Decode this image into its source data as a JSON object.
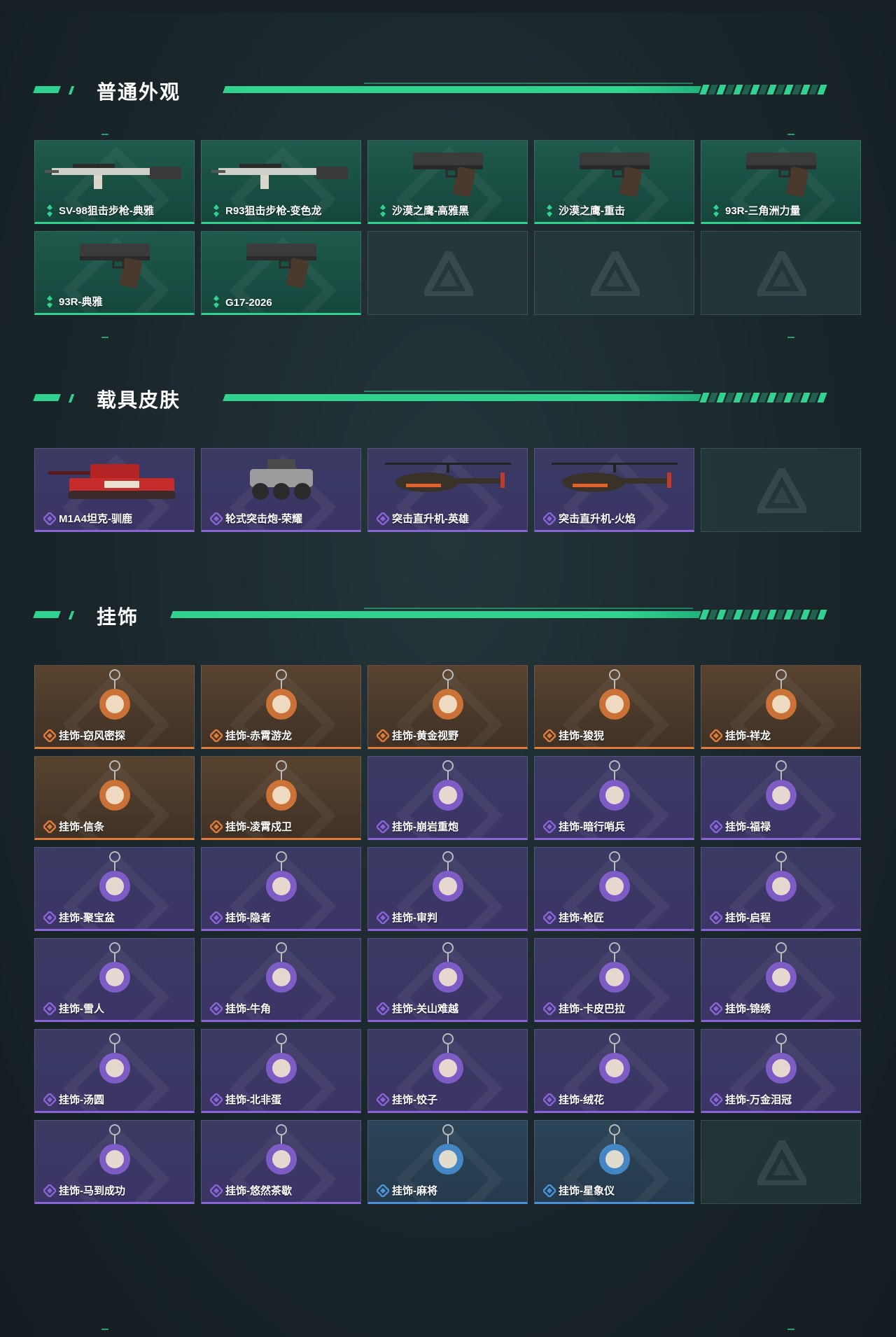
{
  "sections": [
    {
      "title": "普通外观",
      "items": [
        {
          "name": "SV-98狙击步枪-典雅",
          "tier": "green",
          "icon": "sniper-rifle-icon"
        },
        {
          "name": "R93狙击步枪-变色龙",
          "tier": "green",
          "icon": "sniper-rifle-icon"
        },
        {
          "name": "沙漠之鹰-高雅黑",
          "tier": "green",
          "icon": "pistol-icon"
        },
        {
          "name": "沙漠之鹰-重击",
          "tier": "green",
          "icon": "pistol-icon"
        },
        {
          "name": "93R-三角洲力量",
          "tier": "green",
          "icon": "pistol-icon"
        },
        {
          "name": "93R-典雅",
          "tier": "green",
          "icon": "pistol-icon"
        },
        {
          "name": "G17-2026",
          "tier": "green",
          "icon": "pistol-icon"
        }
      ],
      "empty_slots": 3
    },
    {
      "title": "载具皮肤",
      "items": [
        {
          "name": "M1A4坦克-驯鹿",
          "tier": "purple",
          "icon": "tank-icon"
        },
        {
          "name": "轮式突击炮-荣耀",
          "tier": "purple",
          "icon": "armored-car-icon"
        },
        {
          "name": "突击直升机-英雄",
          "tier": "purple",
          "icon": "helicopter-icon"
        },
        {
          "name": "突击直升机-火焰",
          "tier": "purple",
          "icon": "helicopter-icon"
        }
      ],
      "empty_slots": 1
    },
    {
      "title": "挂饰",
      "items": [
        {
          "name": "挂饰-窃风密探",
          "tier": "orange",
          "icon": "charm-icon"
        },
        {
          "name": "挂饰-赤霄游龙",
          "tier": "orange",
          "icon": "charm-icon"
        },
        {
          "name": "挂饰-黄金视野",
          "tier": "orange",
          "icon": "charm-icon"
        },
        {
          "name": "挂饰-狻猊",
          "tier": "orange",
          "icon": "charm-icon"
        },
        {
          "name": "挂饰-祥龙",
          "tier": "orange",
          "icon": "charm-icon"
        },
        {
          "name": "挂饰-信条",
          "tier": "orange",
          "icon": "charm-icon"
        },
        {
          "name": "挂饰-凌霄戍卫",
          "tier": "orange",
          "icon": "charm-icon"
        },
        {
          "name": "挂饰-崩岩重炮",
          "tier": "purple",
          "icon": "charm-icon"
        },
        {
          "name": "挂饰-暗行哨兵",
          "tier": "purple",
          "icon": "charm-icon"
        },
        {
          "name": "挂饰-福禄",
          "tier": "purple",
          "icon": "charm-icon"
        },
        {
          "name": "挂饰-聚宝盆",
          "tier": "purple",
          "icon": "charm-icon"
        },
        {
          "name": "挂饰-隐者",
          "tier": "purple",
          "icon": "charm-icon"
        },
        {
          "name": "挂饰-审判",
          "tier": "purple",
          "icon": "charm-icon"
        },
        {
          "name": "挂饰-枪匠",
          "tier": "purple",
          "icon": "charm-icon"
        },
        {
          "name": "挂饰-启程",
          "tier": "purple",
          "icon": "charm-icon"
        },
        {
          "name": "挂饰-雪人",
          "tier": "purple",
          "icon": "charm-icon"
        },
        {
          "name": "挂饰-牛角",
          "tier": "purple",
          "icon": "charm-icon"
        },
        {
          "name": "挂饰-关山难越",
          "tier": "purple",
          "icon": "charm-icon"
        },
        {
          "name": "挂饰-卡皮巴拉",
          "tier": "purple",
          "icon": "charm-icon"
        },
        {
          "name": "挂饰-锦绣",
          "tier": "purple",
          "icon": "charm-icon"
        },
        {
          "name": "挂饰-汤圆",
          "tier": "purple",
          "icon": "charm-icon"
        },
        {
          "name": "挂饰-北非蛋",
          "tier": "purple",
          "icon": "charm-icon"
        },
        {
          "name": "挂饰-饺子",
          "tier": "purple",
          "icon": "charm-icon"
        },
        {
          "name": "挂饰-绒花",
          "tier": "purple",
          "icon": "charm-icon"
        },
        {
          "name": "挂饰-万金泪冠",
          "tier": "purple",
          "icon": "charm-icon"
        },
        {
          "name": "挂饰-马到成功",
          "tier": "purple",
          "icon": "charm-icon"
        },
        {
          "name": "挂饰-悠然茶歇",
          "tier": "purple",
          "icon": "charm-icon"
        },
        {
          "name": "挂饰-麻将",
          "tier": "blue",
          "icon": "charm-icon"
        },
        {
          "name": "挂饰-星象仪",
          "tier": "blue",
          "icon": "charm-icon"
        }
      ],
      "empty_slots": 1
    }
  ],
  "tier_colors": {
    "green": "#2fd38f",
    "purple": "#8a63d6",
    "orange": "#e07b3a",
    "blue": "#4a93d8"
  }
}
